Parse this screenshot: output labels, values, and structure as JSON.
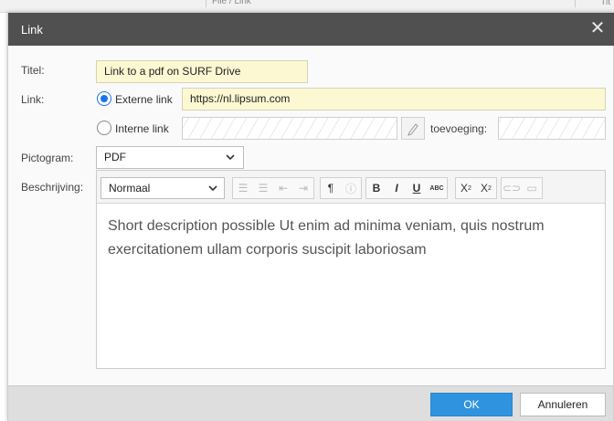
{
  "background": {
    "breadcrumb": "File / Link",
    "right_text": "Tit"
  },
  "dialog": {
    "title": "Link",
    "close_icon": "close-icon",
    "fields": {
      "titel_label": "Titel:",
      "titel_value": "Link to a pdf on SURF Drive",
      "link_label": "Link:",
      "externe_label": "Externe link",
      "externe_value": "https://nl.lipsum.com",
      "interne_label": "Interne link",
      "toevoeging_label": "toevoeging:",
      "pictogram_label": "Pictogram:",
      "pictogram_value": "PDF",
      "beschrijving_label": "Beschrijving:"
    },
    "link_type_selected": "Externe link",
    "editor": {
      "format_value": "Normaal",
      "toolbar_icons": [
        "bulleted-list-icon",
        "numbered-list-icon",
        "outdent-icon",
        "indent-icon",
        "paragraph-icon",
        "info-icon",
        "bold-icon",
        "italic-icon",
        "underline-icon",
        "strikethrough-icon",
        "subscript-icon",
        "superscript-icon",
        "link-icon",
        "image-icon"
      ],
      "content": "Short description possible Ut enim ad minima veniam, quis nostrum exercitationem ullam corporis suscipit laboriosam"
    },
    "buttons": {
      "ok": "OK",
      "cancel": "Annuleren"
    }
  },
  "colors": {
    "titlebar": "#505050",
    "primary": "#2f93e0",
    "highlight_field": "#fcf8d2"
  }
}
